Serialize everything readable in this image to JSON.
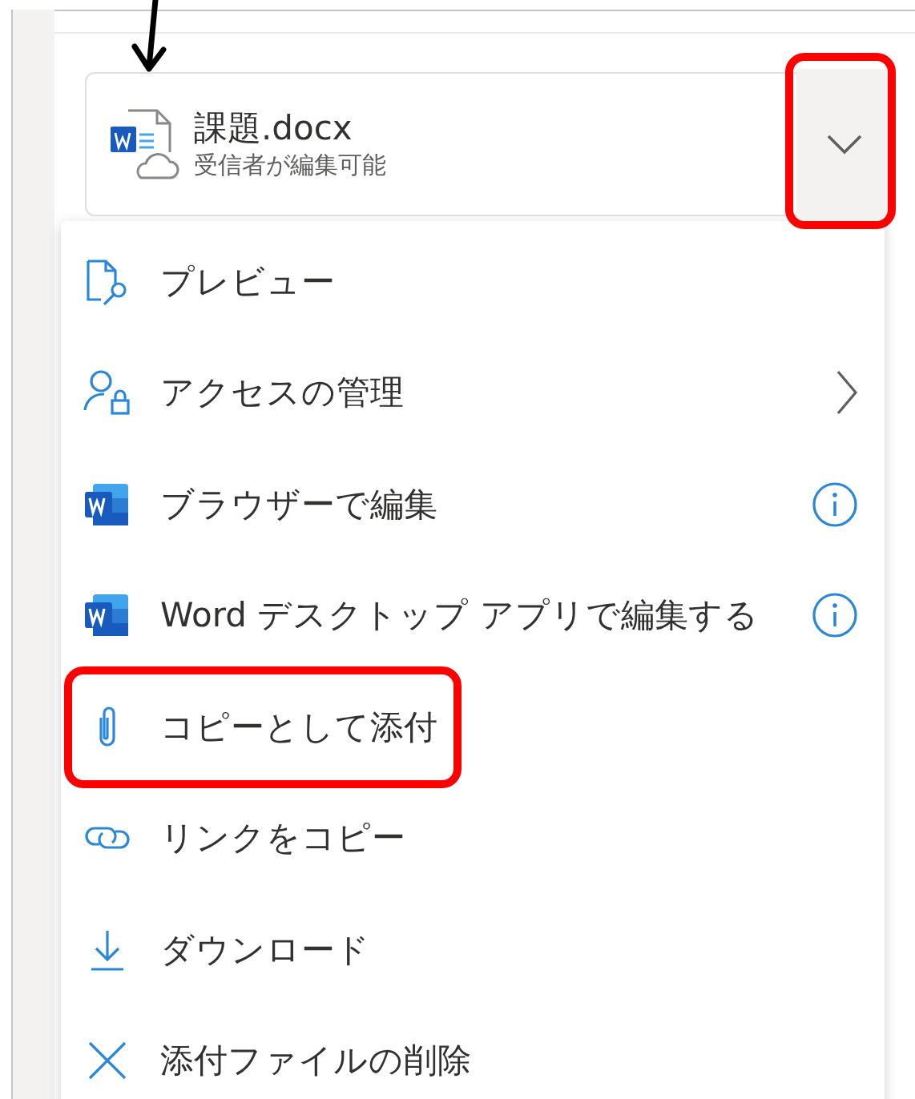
{
  "attachment": {
    "name": "課題.docx",
    "permission": "受信者が編集可能",
    "pointed": true,
    "dropdown": {
      "highlighted": true
    }
  },
  "menu": {
    "items": [
      {
        "label": "プレビュー",
        "kind": "preview",
        "has_submenu": false,
        "has_info": false,
        "highlighted": false
      },
      {
        "label": "アクセスの管理",
        "kind": "access",
        "has_submenu": true,
        "has_info": false,
        "highlighted": false
      },
      {
        "label": "ブラウザーで編集",
        "kind": "word",
        "has_submenu": false,
        "has_info": true,
        "highlighted": false
      },
      {
        "label": "Word デスクトップ アプリで編集する",
        "kind": "word",
        "has_submenu": false,
        "has_info": true,
        "highlighted": false
      },
      {
        "label": "コピーとして添付",
        "kind": "attach",
        "has_submenu": false,
        "has_info": false,
        "highlighted": true
      },
      {
        "label": "リンクをコピー",
        "kind": "link",
        "has_submenu": false,
        "has_info": false,
        "highlighted": false
      },
      {
        "label": "ダウンロード",
        "kind": "download",
        "has_submenu": false,
        "has_info": false,
        "highlighted": false
      },
      {
        "label": "添付ファイルの削除",
        "kind": "remove",
        "has_submenu": false,
        "has_info": false,
        "highlighted": false
      }
    ]
  }
}
